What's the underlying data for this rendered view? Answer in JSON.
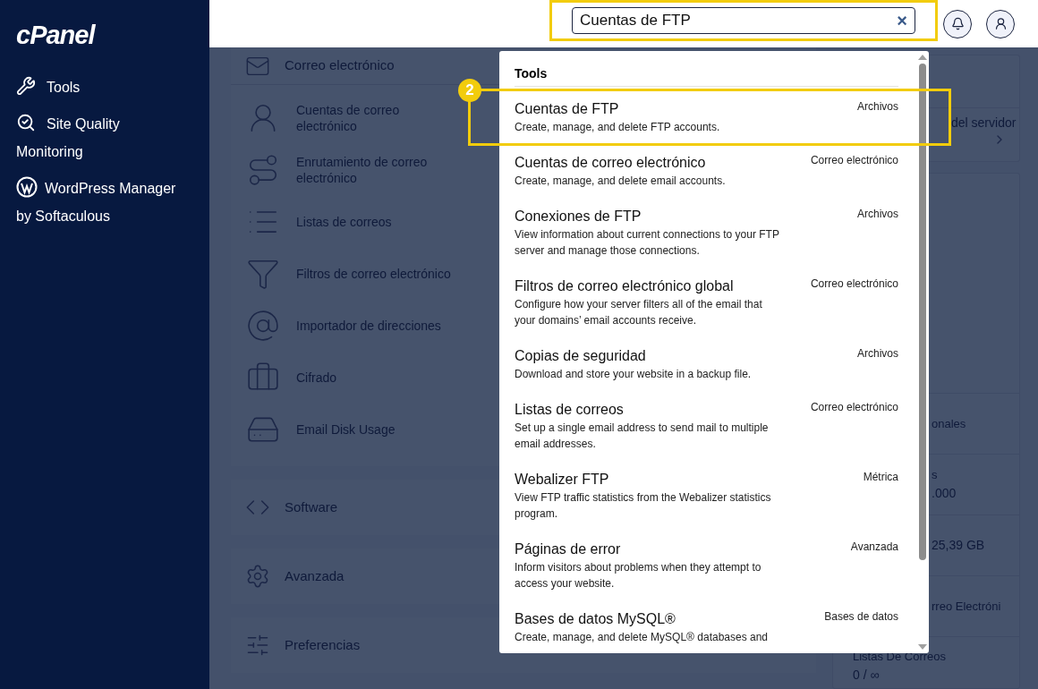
{
  "sidebar": {
    "logo": "cPanel",
    "items": [
      {
        "label": "Tools"
      },
      {
        "label": "Site Quality Monitoring"
      },
      {
        "label": "WordPress Manager by Softaculous"
      }
    ]
  },
  "header": {
    "search": {
      "value": "Cuentas de FTP",
      "clear": "×",
      "highlighted": true
    }
  },
  "background": {
    "email_section": {
      "title": "Correo electrónico",
      "items": [
        {
          "label": "Cuentas de correo electrónico"
        },
        {
          "label": "Enrutamiento de correo electrónico"
        },
        {
          "label": "Listas de correos"
        },
        {
          "label": "Filtros de correo electrónico"
        },
        {
          "label": "Importador de direcciones"
        },
        {
          "label": "Cifrado"
        },
        {
          "label": "Email Disk Usage"
        }
      ]
    },
    "sections": [
      {
        "title": "Software"
      },
      {
        "title": "Avanzada"
      },
      {
        "title": "Preferencias"
      }
    ],
    "side_panel": {
      "link": "del servidor",
      "stats": [
        {
          "label": "onales"
        },
        {
          "label": "s",
          "value": ".000"
        },
        {
          "value": "25,39 GB"
        },
        {
          "label": "rreo Electróni"
        },
        {
          "label": "Listas De Correos",
          "value": "0 / ∞"
        }
      ]
    }
  },
  "results": {
    "heading": "Tools",
    "items": [
      {
        "title": "Cuentas de FTP",
        "description": "Create, manage, and delete FTP accounts.",
        "category": "Archivos",
        "highlighted": true,
        "badge": "2"
      },
      {
        "title": "Cuentas de correo electrónico",
        "description": "Create, manage, and delete email accounts.",
        "category": "Correo electrónico",
        "highlighted": false
      },
      {
        "title": "Conexiones de FTP",
        "description": "View information about current connections to your FTP server and manage those connections.",
        "category": "Archivos",
        "highlighted": false
      },
      {
        "title": "Filtros de correo electrónico global",
        "description": "Configure how your server filters all of the email that your domains’ email accounts receive.",
        "category": "Correo electrónico",
        "highlighted": false
      },
      {
        "title": "Copias de seguridad",
        "description": "Download and store your website in a backup file.",
        "category": "Archivos",
        "highlighted": false
      },
      {
        "title": "Listas de correos",
        "description": "Set up a single email address to send mail to multiple email addresses.",
        "category": "Correo electrónico",
        "highlighted": false
      },
      {
        "title": "Webalizer FTP",
        "description": "View FTP traffic statistics from the Webalizer statistics program.",
        "category": "Métrica",
        "highlighted": false
      },
      {
        "title": "Páginas de error",
        "description": "Inform visitors about problems when they attempt to access your website.",
        "category": "Avanzada",
        "highlighted": false
      },
      {
        "title": "Bases de datos MySQL®",
        "description": "Create, manage, and delete MySQL® databases and",
        "category": "Bases de datos",
        "highlighted": false
      }
    ]
  }
}
